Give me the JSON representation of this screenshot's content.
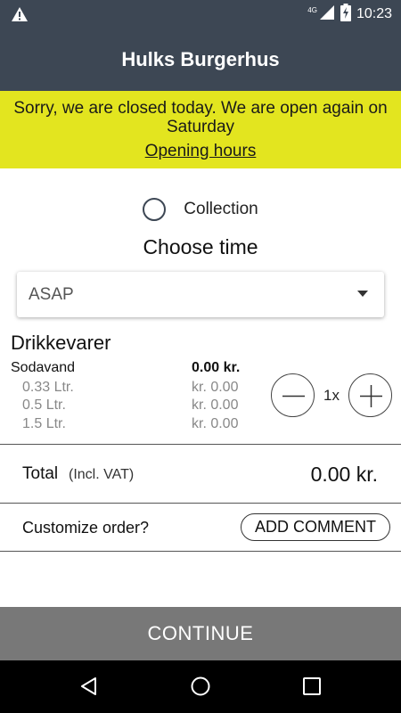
{
  "status_bar": {
    "time": "10:23",
    "network": "4G",
    "icons": [
      "warning-icon",
      "signal-icon",
      "battery-charging-icon"
    ]
  },
  "header": {
    "title": "Hulks Burgerhus"
  },
  "notice": {
    "message": "Sorry, we are closed today. We are open again on Saturday",
    "link": "Opening hours",
    "background": "#e3e51f"
  },
  "delivery": {
    "option_label": "Collection",
    "selected": false
  },
  "time_picker": {
    "heading": "Choose time",
    "selected_value": "ASAP"
  },
  "menu": {
    "category": "Drikkevarer",
    "product": {
      "name": "Sodavand",
      "price": "0.00 kr.",
      "variants": [
        {
          "size": "0.33 Ltr.",
          "price": "kr. 0.00"
        },
        {
          "size": "0.5 Ltr.",
          "price": "kr. 0.00"
        },
        {
          "size": "1.5 Ltr.",
          "price": "kr. 0.00"
        }
      ],
      "quantity": "1x"
    }
  },
  "total": {
    "label": "Total",
    "note": "(Incl. VAT)",
    "amount": "0.00 kr."
  },
  "customize": {
    "label": "Customize order?",
    "button": "ADD COMMENT"
  },
  "footer": {
    "continue": "CONTINUE",
    "continue_color": "#787878"
  },
  "theme": {
    "primary": "#3d4754",
    "notice": "#e3e51f"
  },
  "nav_bar": {
    "icons": [
      "back-icon",
      "home-icon",
      "recents-icon"
    ]
  }
}
